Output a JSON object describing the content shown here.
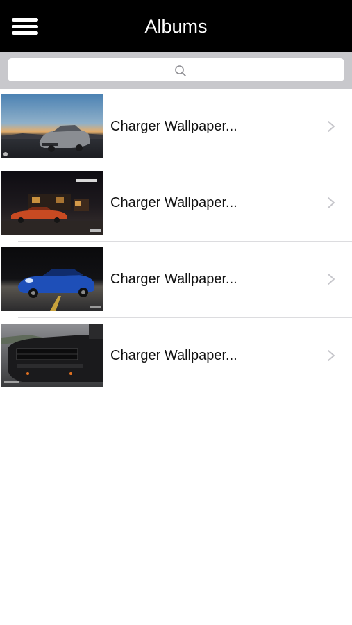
{
  "header": {
    "title": "Albums",
    "menu_icon": "hamburger-menu-icon"
  },
  "search": {
    "placeholder": "",
    "icon": "search-icon"
  },
  "albums": [
    {
      "label": "Charger Wallpaper..."
    },
    {
      "label": "Charger Wallpaper..."
    },
    {
      "label": "Charger Wallpaper..."
    },
    {
      "label": "Charger Wallpaper..."
    }
  ],
  "colors": {
    "nav_bg": "#000000",
    "search_bar_bg": "#c8c8cc",
    "separator": "#dcdcdf",
    "chevron": "#c7c7cc"
  }
}
